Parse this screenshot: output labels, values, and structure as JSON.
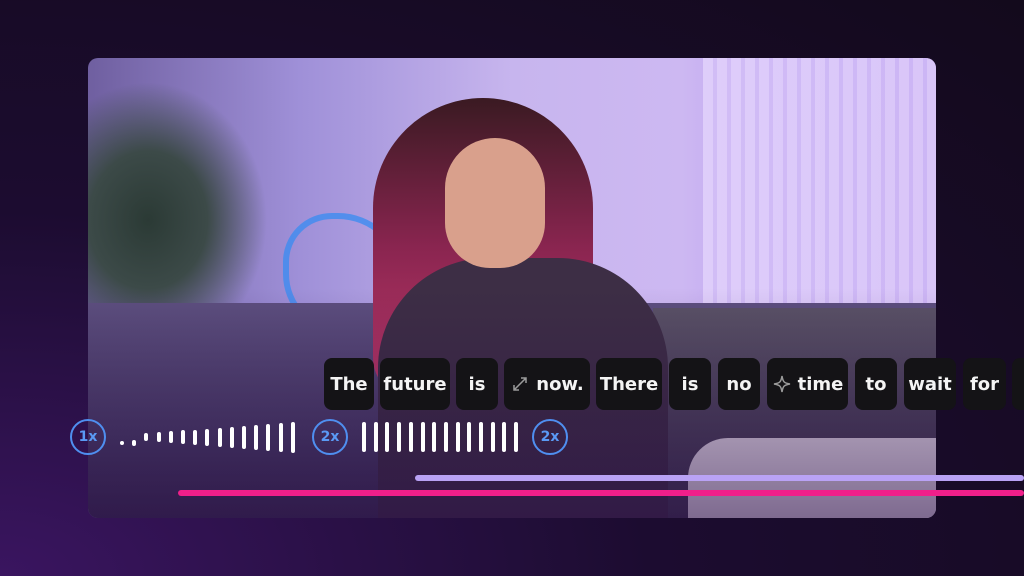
{
  "transcript": {
    "words": [
      {
        "text": "The",
        "icon": null
      },
      {
        "text": "future",
        "icon": null
      },
      {
        "text": "is",
        "icon": null
      },
      {
        "text": "now.",
        "icon": "expand-arrows-icon"
      },
      {
        "text": "There",
        "icon": null
      },
      {
        "text": "is",
        "icon": null
      },
      {
        "text": "no",
        "icon": null
      },
      {
        "text": "time",
        "icon": "sparkle-icon"
      },
      {
        "text": "to",
        "icon": null
      },
      {
        "text": "wait",
        "icon": null
      },
      {
        "text": "for",
        "icon": null
      },
      {
        "text": "",
        "icon": null
      }
    ]
  },
  "speed_markers": [
    "1x",
    "2x",
    "2x"
  ],
  "colors": {
    "accent_blue": "#4f8ff0",
    "progress_pink": "#f01f8a",
    "progress_lavender": "#b9a2f5",
    "chip_bg": "#141316"
  }
}
